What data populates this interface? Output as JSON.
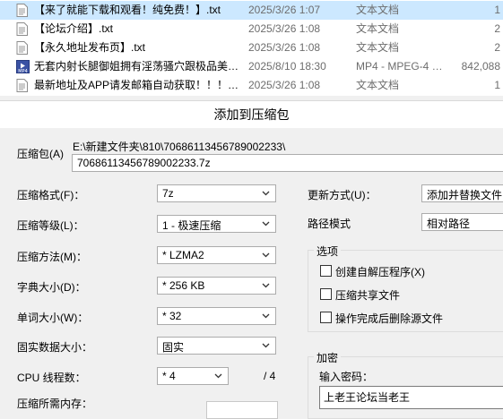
{
  "files": [
    {
      "name": "【来了就能下载和观看！纯免费！】.txt",
      "date": "2025/3/26 1:07",
      "type": "文本文档",
      "size": "1",
      "icon": "text-file-icon",
      "selected": true
    },
    {
      "name": "【论坛介绍】.txt",
      "date": "2025/3/26 1:08",
      "type": "文本文档",
      "size": "2",
      "icon": "text-file-icon",
      "selected": false
    },
    {
      "name": "【永久地址发布页】.txt",
      "date": "2025/3/26 1:08",
      "type": "文本文档",
      "size": "2",
      "icon": "text-file-icon",
      "selected": false
    },
    {
      "name": "无套内射长腿御姐拥有淫荡骚穴跟极品美…",
      "date": "2025/8/10 18:30",
      "type": "MP4 - MPEG-4 …",
      "size": "842,088",
      "icon": "mp4-video-icon",
      "selected": false
    },
    {
      "name": "最新地址及APP请发邮箱自动获取！！！…",
      "date": "2025/3/26 1:08",
      "type": "文本文档",
      "size": "1",
      "icon": "text-file-icon",
      "selected": false
    }
  ],
  "dialog": {
    "title": "添加到压缩包",
    "archive_label": "压缩包(A)",
    "archive_path": "E:\\新建文件夹\\810\\70686113456789002233\\",
    "archive_name": "70686113456789002233.7z",
    "format_label": "压缩格式(F)：",
    "format_value": "7z",
    "level_label": "压缩等级(L)：",
    "level_value": "1 - 极速压缩",
    "method_label": "压缩方法(M)：",
    "method_value": "* LZMA2",
    "dict_label": "字典大小(D)：",
    "dict_value": "* 256 KB",
    "word_label": "单词大小(W)：",
    "word_value": "* 32",
    "solid_label": "固实数据大小：",
    "solid_value": "固实",
    "cpu_label": "CPU 线程数：",
    "cpu_value": "* 4",
    "cpu_total": "/ 4",
    "memory_label": "压缩所需内存：",
    "update_label": "更新方式(U)：",
    "update_value": "添加并替换文件",
    "path_label": "路径模式",
    "path_value": "相对路径",
    "options_title": "选项",
    "options": [
      "创建自解压程序(X)",
      "压缩共享文件",
      "操作完成后删除源文件"
    ],
    "encrypt_title": "加密",
    "password_label": "输入密码：",
    "password_value": "上老王论坛当老王"
  }
}
